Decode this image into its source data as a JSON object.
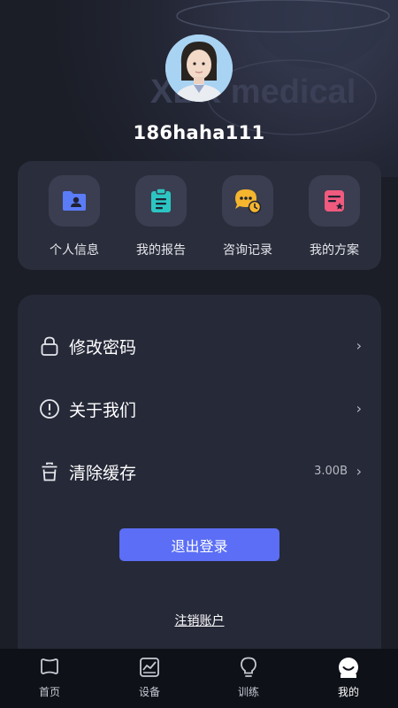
{
  "profile": {
    "username": "186haha111",
    "watermark_text": "XBK medical"
  },
  "quick_actions": [
    {
      "label": "个人信息",
      "icon": "personal-info-folder-icon",
      "color": "#5b7cf7"
    },
    {
      "label": "我的报告",
      "icon": "report-clipboard-icon",
      "color": "#2cc6c2"
    },
    {
      "label": "咨询记录",
      "icon": "consultation-chat-clock-icon",
      "color": "#f5b52e"
    },
    {
      "label": "我的方案",
      "icon": "plan-document-star-icon",
      "color": "#ef5a7e"
    }
  ],
  "menu": {
    "change_password": {
      "label": "修改密码",
      "icon": "lock-icon"
    },
    "about_us": {
      "label": "关于我们",
      "icon": "info-circle-icon"
    },
    "clear_cache": {
      "label": "清除缓存",
      "icon": "trash-icon",
      "value": "3.00B"
    },
    "chevron": "›"
  },
  "actions": {
    "logout_label": "退出登录",
    "deregister_label": "注销账户"
  },
  "tabbar": [
    {
      "label": "首页",
      "icon": "home-icon",
      "active": false
    },
    {
      "label": "设备",
      "icon": "device-chart-icon",
      "active": false
    },
    {
      "label": "训练",
      "icon": "training-bulb-icon",
      "active": false
    },
    {
      "label": "我的",
      "icon": "profile-icon",
      "active": true
    }
  ],
  "colors": {
    "accent": "#5b6ef5",
    "background": "#1b1e27",
    "card": "#262938"
  }
}
